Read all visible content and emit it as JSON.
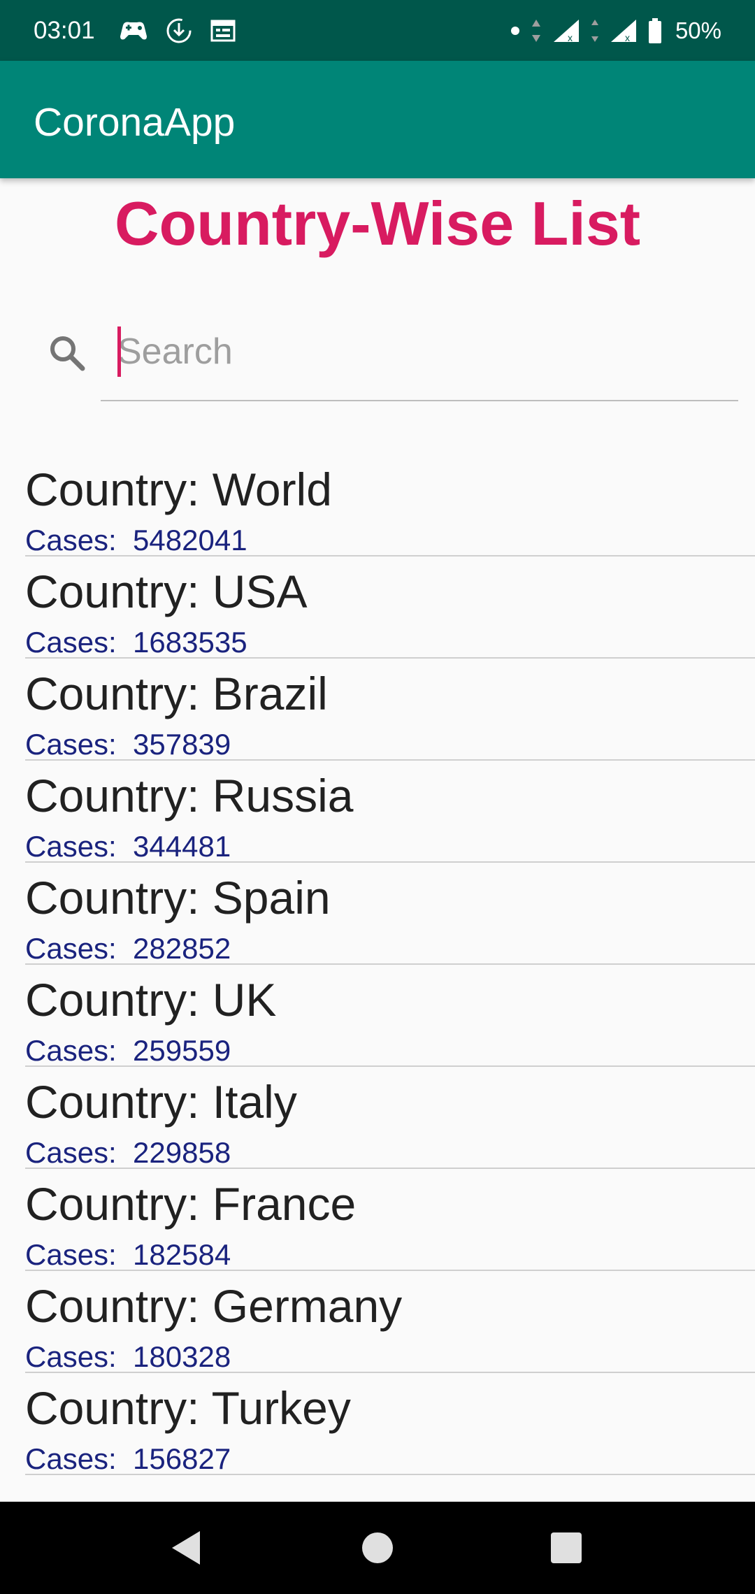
{
  "status_bar": {
    "time": "03:01",
    "battery": "50%",
    "left_icons": [
      "game-controller-icon",
      "download-icon",
      "calendar-icon"
    ],
    "right_icons": [
      "dot-icon",
      "data-arrows-icon",
      "signal-icon",
      "signal-icon",
      "battery-icon"
    ]
  },
  "app_bar": {
    "title": "CoronaApp"
  },
  "heading": "Country-Wise List",
  "search": {
    "placeholder": "Search",
    "value": ""
  },
  "countries": [
    {
      "country": "Country: World",
      "cases": "Cases:  5482041"
    },
    {
      "country": "Country: USA",
      "cases": "Cases:  1683535"
    },
    {
      "country": "Country: Brazil",
      "cases": "Cases:  357839"
    },
    {
      "country": "Country: Russia",
      "cases": "Cases:  344481"
    },
    {
      "country": "Country: Spain",
      "cases": "Cases:  282852"
    },
    {
      "country": "Country: UK",
      "cases": "Cases:  259559"
    },
    {
      "country": "Country: Italy",
      "cases": "Cases:  229858"
    },
    {
      "country": "Country: France",
      "cases": "Cases:  182584"
    },
    {
      "country": "Country: Germany",
      "cases": "Cases:  180328"
    },
    {
      "country": "Country: Turkey",
      "cases": "Cases:  156827"
    }
  ],
  "colors": {
    "status_bar": "#00574b",
    "app_bar": "#008577",
    "accent": "#d81b60",
    "cases_text": "#1a237e"
  },
  "nav": [
    "back-icon",
    "home-icon",
    "recents-icon"
  ]
}
